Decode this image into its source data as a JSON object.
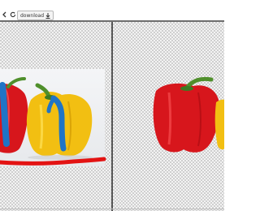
{
  "toolbar": {
    "download_label": "download"
  },
  "colors": {
    "red_pepper": "#d7161c",
    "yellow_pepper": "#f2bf12",
    "stem_green": "#4f8f2b",
    "blue_stroke": "#1f74c6",
    "red_stroke": "#e31313",
    "separator": "#6e6e6e"
  },
  "icons": {
    "back": "back-arrow-icon",
    "refresh": "refresh-icon",
    "download": "download-icon"
  },
  "canvas": {
    "mask_strokes": [
      "blue",
      "blue",
      "red"
    ]
  }
}
